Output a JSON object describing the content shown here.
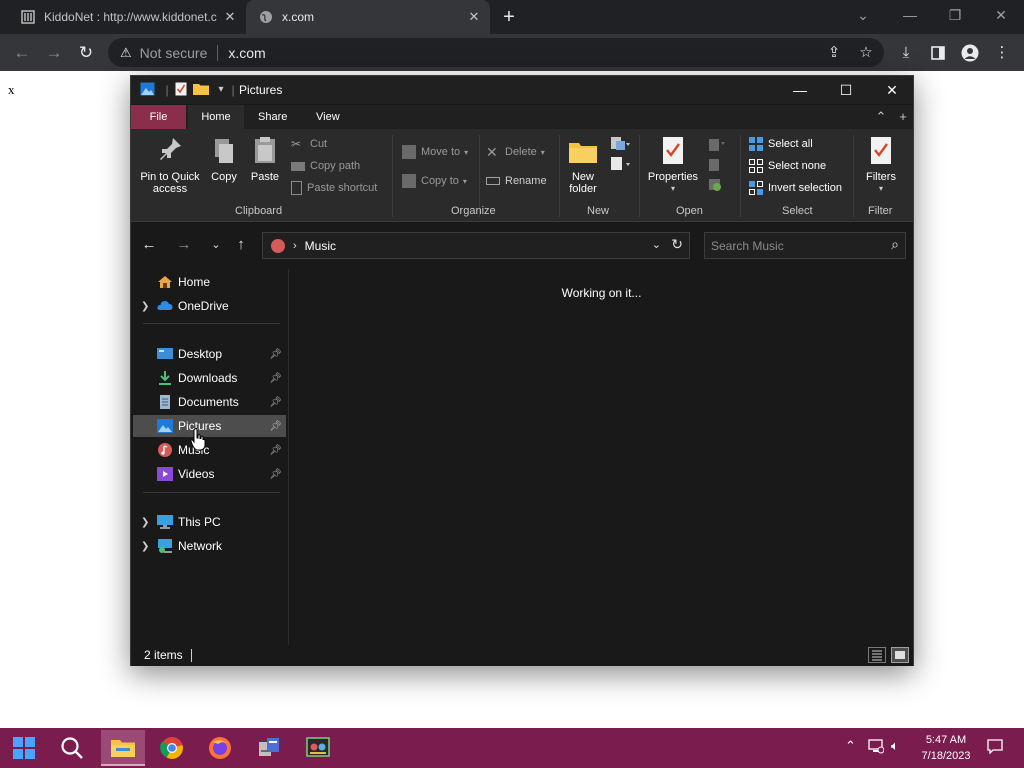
{
  "browser": {
    "tabs": [
      {
        "title": "KiddoNet : http://www.kiddonet.c",
        "close": "✕"
      },
      {
        "title": "x.com",
        "close": "✕"
      }
    ],
    "new_tab": "+",
    "omnibox": {
      "security": "Not secure",
      "url": "x.com"
    }
  },
  "page": {
    "body_text": "x"
  },
  "explorer": {
    "window_title": "Pictures",
    "ribbon_tabs": [
      "File",
      "Home",
      "Share",
      "View"
    ],
    "ribbon": {
      "clipboard": {
        "label": "Clipboard",
        "pin": "Pin to Quick access",
        "copy": "Copy",
        "paste": "Paste",
        "cut": "Cut",
        "copy_path": "Copy path",
        "paste_shortcut": "Paste shortcut"
      },
      "organize": {
        "label": "Organize",
        "move_to": "Move to",
        "copy_to": "Copy to",
        "delete": "Delete",
        "rename": "Rename"
      },
      "new": {
        "label": "New",
        "new_folder": "New folder"
      },
      "open": {
        "label": "Open",
        "properties": "Properties"
      },
      "select": {
        "label": "Select",
        "select_all": "Select all",
        "select_none": "Select none",
        "invert": "Invert selection"
      },
      "filter": {
        "label": "Filter",
        "filters": "Filters"
      }
    },
    "address": {
      "path": "Music",
      "search_placeholder": "Search Music"
    },
    "nav": [
      {
        "label": "Home",
        "icon": "home-icon"
      },
      {
        "label": "OneDrive",
        "icon": "onedrive-icon"
      },
      {
        "label": "Desktop",
        "icon": "desktop-icon"
      },
      {
        "label": "Downloads",
        "icon": "downloads-icon"
      },
      {
        "label": "Documents",
        "icon": "documents-icon"
      },
      {
        "label": "Pictures",
        "icon": "pictures-icon",
        "selected": true
      },
      {
        "label": "Music",
        "icon": "music-icon"
      },
      {
        "label": "Videos",
        "icon": "videos-icon"
      },
      {
        "label": "This PC",
        "icon": "this-pc-icon"
      },
      {
        "label": "Network",
        "icon": "network-icon"
      }
    ],
    "content_status": "Working on it...",
    "status": {
      "items": "2 items"
    }
  },
  "taskbar": {
    "time": "5:47 AM",
    "date": "7/18/2023"
  },
  "colors": {
    "taskbar": "#7a1d4e",
    "file_tab": "#8b2e4b",
    "explorer_bg": "#191919"
  }
}
